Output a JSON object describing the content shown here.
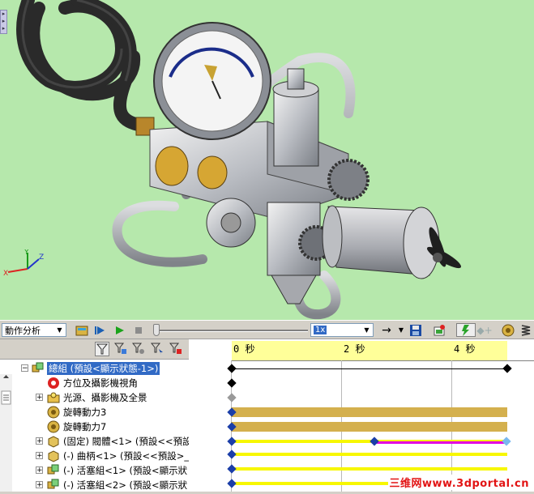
{
  "viewport": {
    "triad": {
      "x": "X",
      "y": "Y",
      "z": "Z"
    }
  },
  "toolbar": {
    "study_type": "動作分析",
    "speed": "1x",
    "icons": [
      "calculate-icon",
      "play-from-start-icon",
      "play-icon",
      "stop-icon",
      "playback-mode-icon",
      "save-animation-icon",
      "animation-wizard-icon",
      "autokey-icon",
      "add-key-icon",
      "motor-icon",
      "spring-icon"
    ]
  },
  "tree_toolbar": {
    "icons": [
      "filter-icon",
      "filter-animating-icon",
      "filter-driving-icon",
      "filter-selected-icon",
      "filter-results-icon"
    ]
  },
  "tree": {
    "items": [
      {
        "label": "總組 (預設<顯示狀態-1>)",
        "icon": "assembly-icon",
        "selected": true,
        "expander": "−"
      },
      {
        "label": "方位及攝影機視角",
        "icon": "orientation-camera-icon",
        "expander": ""
      },
      {
        "label": "光源、攝影機及全景",
        "icon": "lights-camera-scene-icon",
        "expander": "+"
      },
      {
        "label": "旋轉動力3",
        "icon": "rotary-motor-icon",
        "expander": ""
      },
      {
        "label": "旋轉動力7",
        "icon": "rotary-motor-icon",
        "expander": ""
      },
      {
        "label": "(固定) 閥體<1> (預設<<預設",
        "icon": "part-icon",
        "expander": "+"
      },
      {
        "label": "(-) 曲柄<1> (預設<<預設>_",
        "icon": "part-icon",
        "expander": "+"
      },
      {
        "label": "(-) 活塞組<1> (預設<顯示狀",
        "icon": "subassembly-icon",
        "expander": "+"
      },
      {
        "label": "(-) 活塞組<2> (預設<顯示狀",
        "icon": "subassembly-icon",
        "expander": "+"
      }
    ]
  },
  "timeline": {
    "ticks": [
      "0 秒",
      "2 秒",
      "4 秒"
    ],
    "duration_seconds": 5
  },
  "watermark": "三维网www.3dportal.cn",
  "colors": {
    "viewport_bg": "#b6e8ac",
    "selection": "#316ac5",
    "timebar": "#ffff99",
    "motor_bar": "#d4b04e",
    "part_bar": "#f7f700",
    "change_bar": "#e100e1"
  }
}
